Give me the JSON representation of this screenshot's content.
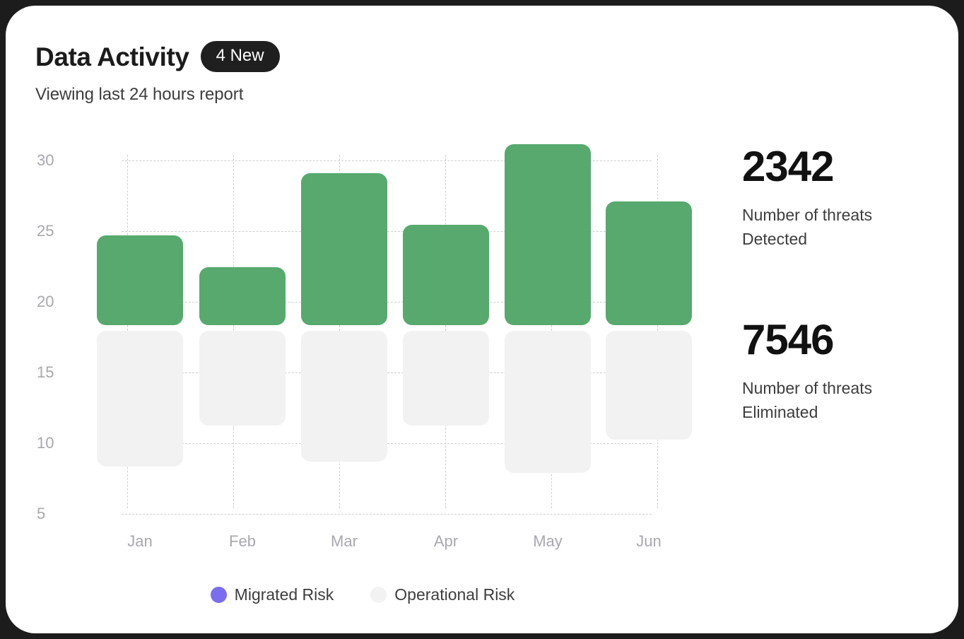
{
  "card": {
    "background": "#ffffff",
    "page_background": "#1c1c1c"
  },
  "header": {
    "title": "Data Activity",
    "badge": "4 New",
    "subtitle": "Viewing last 24 hours report"
  },
  "stats": [
    {
      "value": "2342",
      "label": "Number of threats Detected"
    },
    {
      "value": "7546",
      "label": "Number of threats Eliminated"
    }
  ],
  "legend": [
    {
      "label": "Migrated Risk",
      "color": "#7c6cf0"
    },
    {
      "label": "Operational Risk",
      "color": "#f2f2f2"
    }
  ],
  "colors": {
    "migrated_risk": "#7c6cf0",
    "operational_risk": "#f2f2f2",
    "bar_green": "#57a96d",
    "grid": "#cfcfd4",
    "axis_text": "#a8a8ae",
    "badge_bg": "#1f1f1f"
  },
  "chart_data": {
    "type": "bar",
    "title": "Data Activity",
    "subtitle": "Viewing last 24 hours report",
    "xlabel": "",
    "ylabel": "",
    "categories": [
      "Jan",
      "Feb",
      "Mar",
      "Apr",
      "May",
      "Jun"
    ],
    "ytick_labels": [
      "30",
      "25",
      "20",
      "15",
      "10",
      "5"
    ],
    "yticks": [
      30,
      25,
      20,
      15,
      10,
      5
    ],
    "ylim": [
      5,
      30
    ],
    "grid": true,
    "grid_style": "dashed",
    "legend_position": "bottom-center",
    "stacked": true,
    "series": [
      {
        "name": "Migrated Risk",
        "color": "#57a96d",
        "note": "upper green segment, value = top of green bar",
        "values": [
          24.4,
          23.1,
          27.6,
          24.9,
          30.4,
          26.2
        ]
      },
      {
        "name": "Operational Risk",
        "color": "#f2f2f2",
        "note": "lower grey segment, value = bottom of grey bar",
        "values": [
          9.1,
          12.0,
          9.4,
          12.0,
          8.5,
          10.8
        ]
      }
    ]
  }
}
